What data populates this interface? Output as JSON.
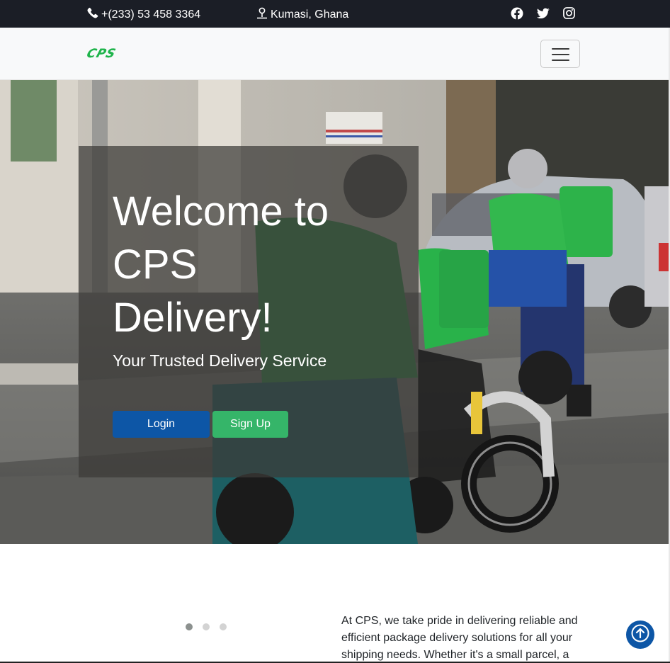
{
  "topbar": {
    "phone": "+(233) 53 458 3364",
    "location": "Kumasi, Ghana",
    "social": [
      "facebook-icon",
      "twitter-icon",
      "instagram-icon"
    ]
  },
  "navbar": {
    "logo": "CPS",
    "menu_icon": "hamburger-icon"
  },
  "hero": {
    "title": "Welcome to CPS Delivery!",
    "subtitle": "Your Trusted Delivery Service",
    "login_label": "Login",
    "signup_label": "Sign Up"
  },
  "carousel": {
    "slides": 3,
    "active": 0
  },
  "about": {
    "text": "At CPS, we take pride in delivering reliable and efficient package delivery solutions for all your shipping needs. Whether it's a small parcel, a"
  },
  "colors": {
    "topbar": "#1b1e26",
    "brand_green": "#1fb44b",
    "primary_blue": "#0d56a6",
    "signup_green": "#35b569"
  }
}
